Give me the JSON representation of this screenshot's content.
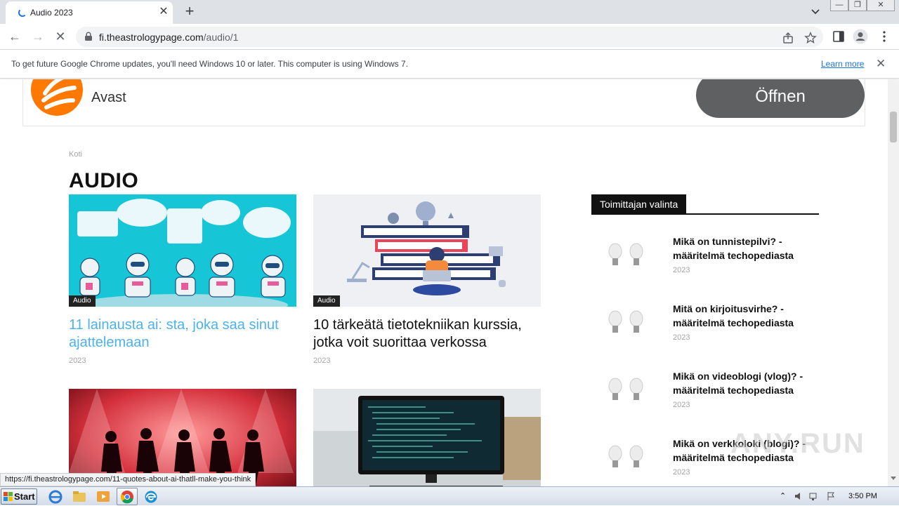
{
  "browser": {
    "tab_title": "Audio 2023",
    "url_host": "fi.theastrologypage.com",
    "url_path": "/audio/1",
    "infobar_message": "To get future Google Chrome updates, you'll need Windows 10 or later. This computer is using Windows 7.",
    "infobar_link": "Learn more",
    "status_url": "https://fi.theastrologypage.com/11-quotes-about-ai-thatll-make-you-think"
  },
  "ad": {
    "brand": "Avast",
    "button_label": "Öffnen",
    "brand_color": "#ff7800"
  },
  "page": {
    "breadcrumb": "Koti",
    "title": "AUDIO"
  },
  "articles": [
    {
      "category": "Audio",
      "title": "11 lainausta ai: sta, joka saa sinut ajattelemaan",
      "date": "2023",
      "title_color": "#4db2ec"
    },
    {
      "category": "Audio",
      "title": "10 tärkeätä tietotekniikan kurssia, jotka voit suorittaa verkossa",
      "date": "2023",
      "title_color": "#111111"
    }
  ],
  "sidebar": {
    "heading": "Toimittajan valinta",
    "items": [
      {
        "title": "Mikä on tunnistepilvi? - määritelmä techopediasta",
        "date": "2023"
      },
      {
        "title": "Mitä on kirjoitusvirhe? - määritelmä techopediasta",
        "date": "2023"
      },
      {
        "title": "Mikä on videoblogi (vlog)? - määritelmä techopediasta",
        "date": "2023"
      },
      {
        "title": "Mikä on verkkoloki (blogi)? - määritelmä techopediasta",
        "date": "2023"
      }
    ]
  },
  "taskbar": {
    "start_label": "Start",
    "clock": "3:50 PM"
  },
  "watermark": "ANY.RUN",
  "icons": [
    "spinner-icon",
    "close-icon",
    "plus-icon",
    "back-icon",
    "forward-icon",
    "stop-icon",
    "lock-icon",
    "share-icon",
    "star-icon",
    "sidepanel-icon",
    "profile-icon",
    "menu-icon"
  ]
}
